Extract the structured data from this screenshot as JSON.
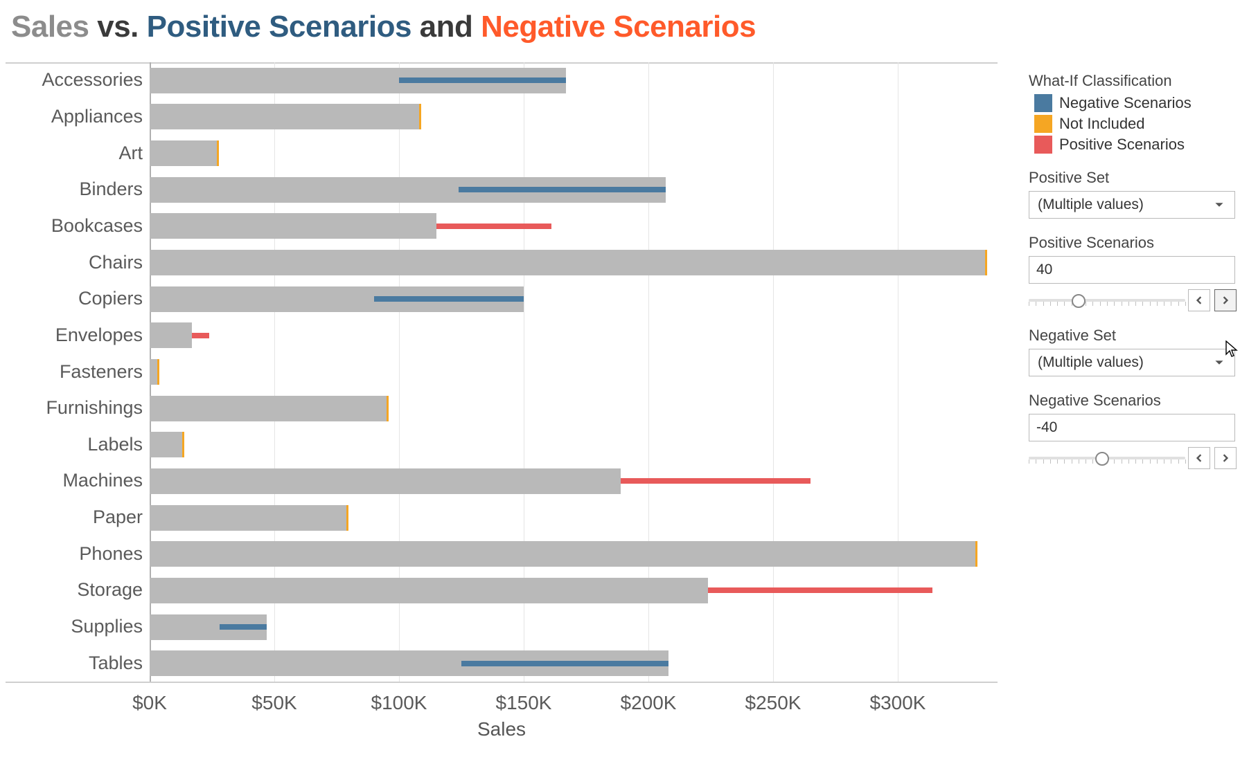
{
  "title": {
    "sales": "Sales",
    "vs": "vs.",
    "positive": "Positive Scenarios",
    "and": "and",
    "negative": "Negative Scenarios"
  },
  "axis": {
    "xlabel": "Sales",
    "ticks": [
      "$0K",
      "$50K",
      "$100K",
      "$150K",
      "$200K",
      "$250K",
      "$300K"
    ]
  },
  "legend": {
    "heading": "What-If Classification",
    "items": [
      {
        "label": "Negative Scenarios",
        "color": "#4a7aa0"
      },
      {
        "label": "Not Included",
        "color": "#f5a623"
      },
      {
        "label": "Positive Scenarios",
        "color": "#e85a5a"
      }
    ]
  },
  "controls": {
    "positive_set_label": "Positive Set",
    "positive_set_value": "(Multiple values)",
    "positive_scenarios_label": "Positive Scenarios",
    "positive_scenarios_value": "40",
    "positive_slider_pos": 0.32,
    "negative_set_label": "Negative Set",
    "negative_set_value": "(Multiple values)",
    "negative_scenarios_label": "Negative Scenarios",
    "negative_scenarios_value": "-40",
    "negative_slider_pos": 0.47
  },
  "chart_data": {
    "type": "bar",
    "xlabel": "Sales",
    "ylabel": "",
    "xlim": [
      0,
      340000
    ],
    "xtick_values": [
      0,
      50000,
      100000,
      150000,
      200000,
      250000,
      300000
    ],
    "note": "Horizontal bar chart. base = gray Sales bar. scenario overlay drawn from scenario_start to scenario_end (thin bar). 'Not Included' categories have a small orange tick at end of base bar.",
    "categories": [
      {
        "name": "Accessories",
        "base": 167000,
        "classification": "Negative Scenarios",
        "scenario_start": 100000,
        "scenario_end": 167000
      },
      {
        "name": "Appliances",
        "base": 108000,
        "classification": "Not Included"
      },
      {
        "name": "Art",
        "base": 27000,
        "classification": "Not Included"
      },
      {
        "name": "Binders",
        "base": 207000,
        "classification": "Negative Scenarios",
        "scenario_start": 124000,
        "scenario_end": 207000
      },
      {
        "name": "Bookcases",
        "base": 115000,
        "classification": "Positive Scenarios",
        "scenario_start": 115000,
        "scenario_end": 161000
      },
      {
        "name": "Chairs",
        "base": 335000,
        "classification": "Not Included"
      },
      {
        "name": "Copiers",
        "base": 150000,
        "classification": "Negative Scenarios",
        "scenario_start": 90000,
        "scenario_end": 150000
      },
      {
        "name": "Envelopes",
        "base": 17000,
        "classification": "Positive Scenarios",
        "scenario_start": 17000,
        "scenario_end": 24000
      },
      {
        "name": "Fasteners",
        "base": 3000,
        "classification": "Not Included"
      },
      {
        "name": "Furnishings",
        "base": 95000,
        "classification": "Not Included"
      },
      {
        "name": "Labels",
        "base": 13000,
        "classification": "Not Included"
      },
      {
        "name": "Machines",
        "base": 189000,
        "classification": "Positive Scenarios",
        "scenario_start": 189000,
        "scenario_end": 265000
      },
      {
        "name": "Paper",
        "base": 79000,
        "classification": "Not Included"
      },
      {
        "name": "Phones",
        "base": 331000,
        "classification": "Not Included"
      },
      {
        "name": "Storage",
        "base": 224000,
        "classification": "Positive Scenarios",
        "scenario_start": 224000,
        "scenario_end": 314000
      },
      {
        "name": "Supplies",
        "base": 47000,
        "classification": "Negative Scenarios",
        "scenario_start": 28000,
        "scenario_end": 47000
      },
      {
        "name": "Tables",
        "base": 208000,
        "classification": "Negative Scenarios",
        "scenario_start": 125000,
        "scenario_end": 208000
      }
    ]
  }
}
